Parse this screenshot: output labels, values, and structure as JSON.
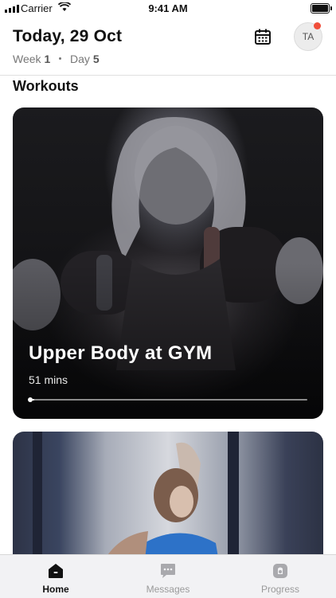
{
  "status_bar": {
    "carrier": "Carrier",
    "time": "9:41 AM"
  },
  "header": {
    "title": "Today, 29 Oct",
    "week_label": "Week",
    "week_value": "1",
    "day_label": "Day",
    "day_value": "5",
    "avatar_initials": "TA",
    "notification_color": "#f04e3a"
  },
  "section_title": "Workouts",
  "workouts": [
    {
      "title": "Upper Body at GYM",
      "duration": "51 mins",
      "progress": 0.02
    },
    {
      "title": "",
      "duration": ""
    }
  ],
  "tabs": [
    {
      "label": "Home",
      "icon": "home-icon",
      "active": true
    },
    {
      "label": "Messages",
      "icon": "messages-icon",
      "active": false
    },
    {
      "label": "Progress",
      "icon": "progress-icon",
      "active": false
    }
  ]
}
